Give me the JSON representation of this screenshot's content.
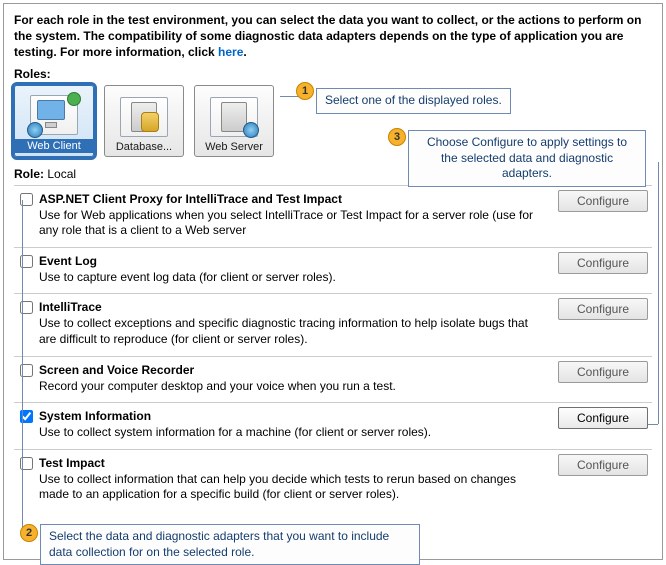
{
  "intro": {
    "text_before_link": "For each role in the test environment, you can select the data you want to collect, or the actions to perform on the system. The compatibility of some diagnostic data adapters depends on the type of application you are testing. For more information, click ",
    "link_text": "here",
    "text_after_link": "."
  },
  "roles_label": "Roles:",
  "roles": [
    {
      "label": "Web Client",
      "selected": true
    },
    {
      "label": "Database...",
      "selected": false
    },
    {
      "label": "Web Server",
      "selected": false
    }
  ],
  "role_line": {
    "prefix": "Role: ",
    "value": "Local"
  },
  "configure_label": "Configure",
  "adapters": [
    {
      "title": "ASP.NET Client Proxy for IntelliTrace and Test Impact",
      "desc": "Use for Web applications when you select IntelliTrace or Test Impact for a server role (use for any role that is a client to a Web server",
      "checked": false,
      "enabled": false
    },
    {
      "title": "Event Log",
      "desc": "Use to capture event log data (for client or server roles).",
      "checked": false,
      "enabled": false
    },
    {
      "title": "IntelliTrace",
      "desc": "Use to collect exceptions and specific diagnostic tracing information to help isolate bugs that are difficult to reproduce (for client or server roles).",
      "checked": false,
      "enabled": false
    },
    {
      "title": "Screen and Voice Recorder",
      "desc": "Record your computer desktop and your voice when you run a test.",
      "checked": false,
      "enabled": false
    },
    {
      "title": "System Information",
      "desc": "Use to collect system information for a machine (for client or server roles).",
      "checked": true,
      "enabled": true
    },
    {
      "title": "Test Impact",
      "desc": "Use to collect information that can help you decide which tests to rerun based on changes made to an application for a specific build (for client or server roles).",
      "checked": false,
      "enabled": false
    }
  ],
  "callouts": {
    "c1": {
      "num": "1",
      "text": "Select one of the displayed roles."
    },
    "c2": {
      "num": "2",
      "text": "Select the data and diagnostic adapters that you want to include data collection for on the selected role."
    },
    "c3": {
      "num": "3",
      "text": "Choose Configure to apply settings to the selected data and diagnostic adapters."
    }
  }
}
